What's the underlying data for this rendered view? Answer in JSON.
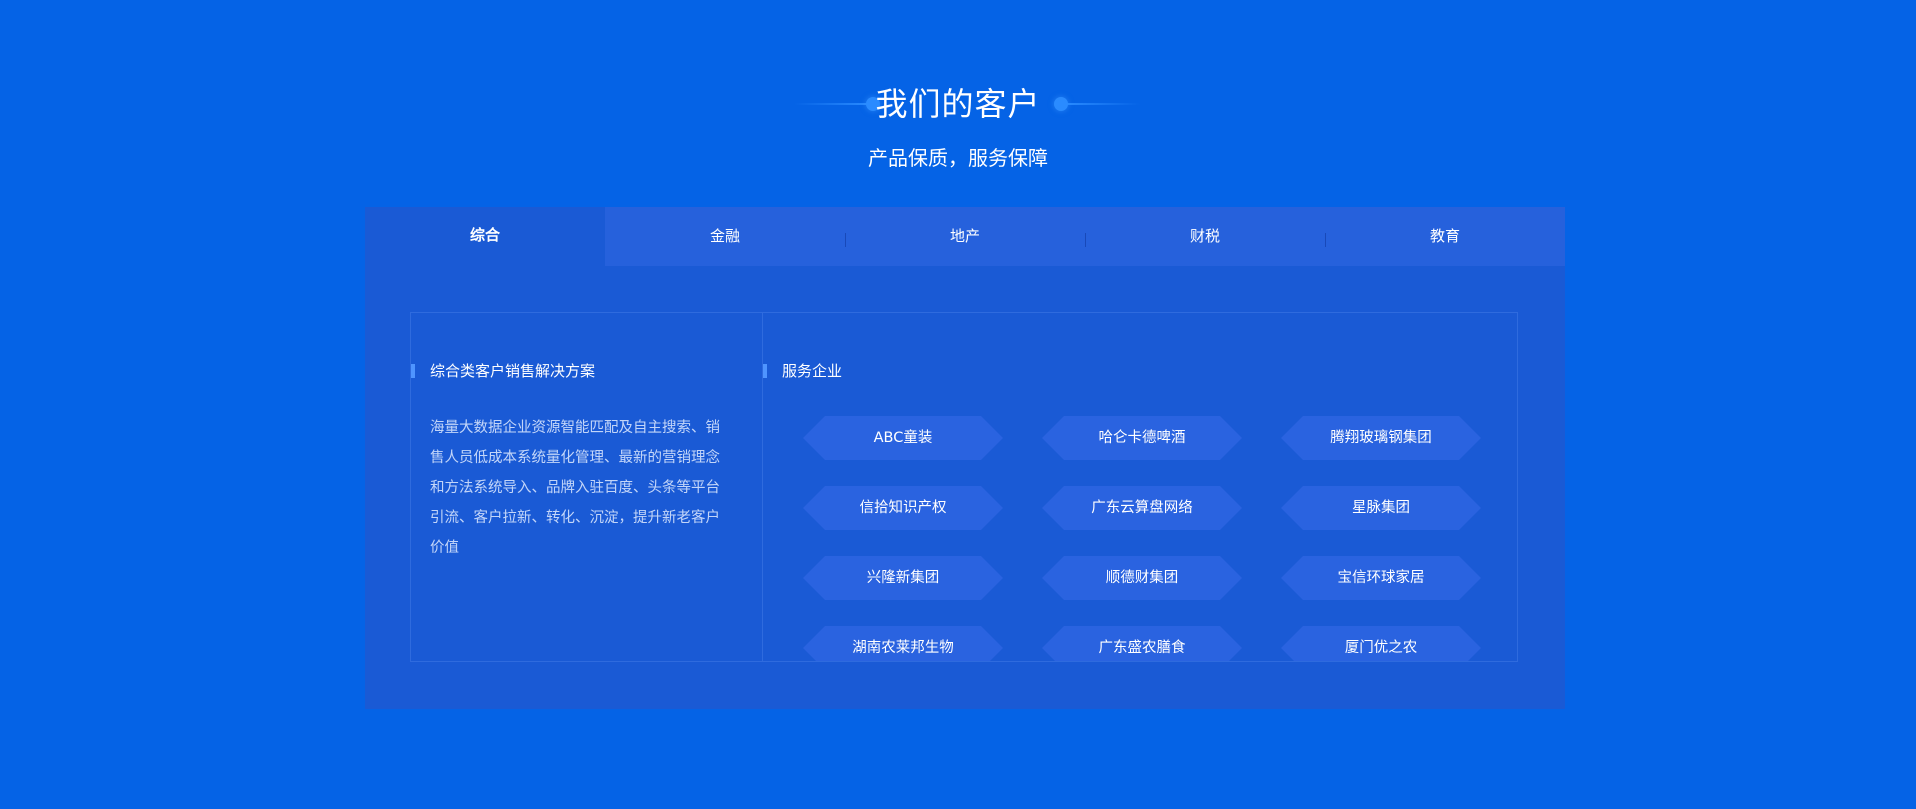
{
  "header": {
    "title": "我们的客户",
    "subtitle": "产品保质，服务保障"
  },
  "tabs": [
    {
      "label": "综合",
      "active": true
    },
    {
      "label": "金融",
      "active": false
    },
    {
      "label": "地产",
      "active": false
    },
    {
      "label": "财税",
      "active": false
    },
    {
      "label": "教育",
      "active": false
    }
  ],
  "solution": {
    "title": "综合类客户销售解决方案",
    "description": "海量大数据企业资源智能匹配及自主搜索、销售人员低成本系统量化管理、最新的营销理念和方法系统导入、品牌入驻百度、头条等平台引流、客户拉新、转化、沉淀，提升新老客户价值"
  },
  "clients": {
    "title": "服务企业",
    "items": [
      "ABC童装",
      "哈仑卡德啤酒",
      "腾翔玻璃钢集团",
      "信拾知识产权",
      "广东云算盘网络",
      "星脉集团",
      "兴隆新集团",
      "顺德财集团",
      "宝信环球家居",
      "湖南农莱邦生物",
      "广东盛农膳食",
      "厦门优之农"
    ]
  },
  "colors": {
    "background": "#0563e6",
    "panel": "#1a5ad5",
    "tab_bar": "#2661dc",
    "hexagon": "#2a63e0",
    "accent": "#4f95ff"
  }
}
